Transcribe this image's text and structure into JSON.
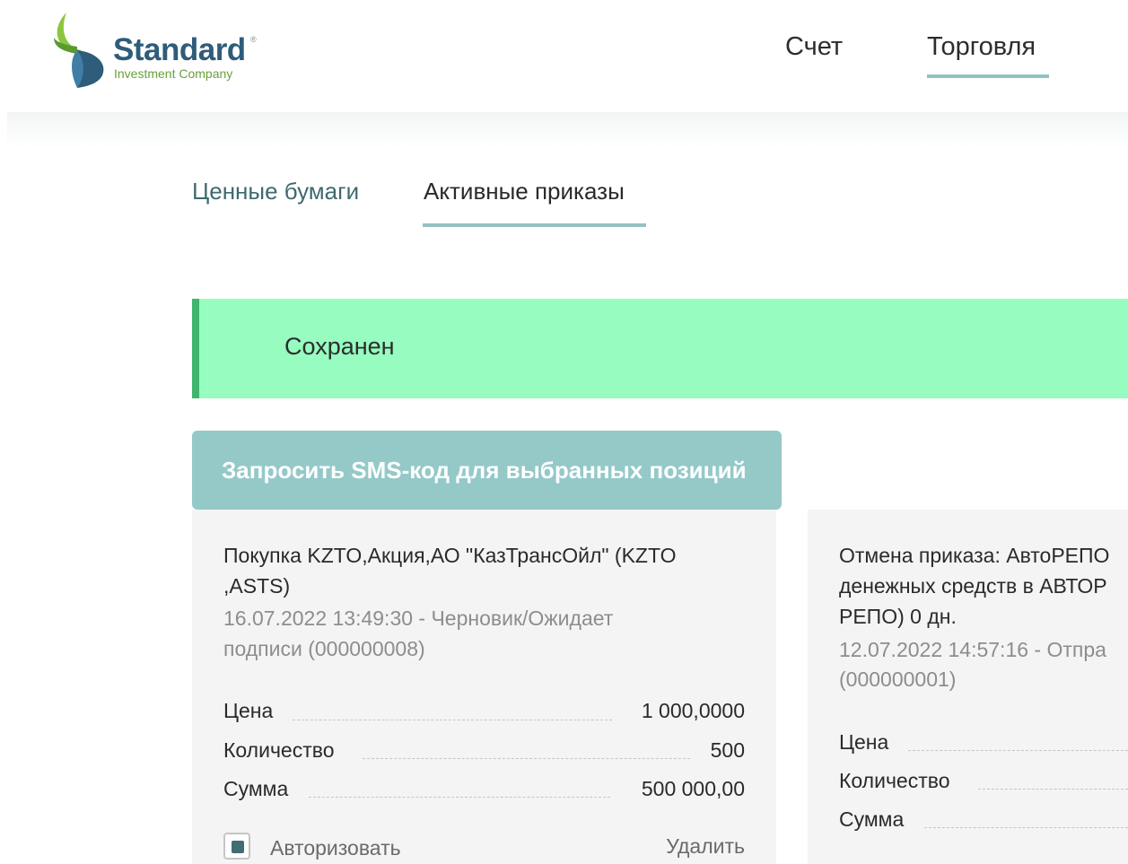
{
  "header": {
    "logo": {
      "name": "Standard",
      "registered": "®",
      "subtitle": "Investment Company"
    },
    "nav": [
      {
        "label": "Счет"
      },
      {
        "label": "Торговля",
        "active": true
      }
    ]
  },
  "tabs": [
    {
      "label": "Ценные бумаги"
    },
    {
      "label": "Активные приказы",
      "active": true
    }
  ],
  "alert": {
    "text": "Сохранен"
  },
  "sms_button": {
    "label": "Запросить SMS-код для выбранных позиций"
  },
  "orders": [
    {
      "title_lines": [
        "Покупка KZTO,Акция,АО \"КазТрансОйл\" (KZTO",
        ",ASTS)"
      ],
      "status_lines": [
        "16.07.2022 13:49:30 - Черновик/Ожидает",
        "подписи (000000008)"
      ],
      "rows": [
        {
          "label": "Цена",
          "value": "1 000,0000"
        },
        {
          "label": "Количество",
          "value": "500"
        },
        {
          "label": "Сумма",
          "value": "500 000,00"
        }
      ],
      "authorize_label": "Авторизовать",
      "authorize_checked": true,
      "delete_label": "Удалить"
    },
    {
      "title_lines": [
        "Отмена приказа: АвтоРЕПО",
        "денежных средств в АВТОР",
        "РЕПО) 0 дн."
      ],
      "status_lines": [
        "12.07.2022 14:57:16 - Отпра",
        "(000000001)"
      ],
      "rows": [
        {
          "label": "Цена"
        },
        {
          "label": "Количество"
        },
        {
          "label": "Сумма"
        }
      ]
    }
  ],
  "colors": {
    "brand_blue": "#2e5c7a",
    "brand_green": "#6aa03a",
    "accent_teal": "#94c9c8",
    "alert_bg": "#96fcc0",
    "alert_border": "#3fb56d"
  }
}
